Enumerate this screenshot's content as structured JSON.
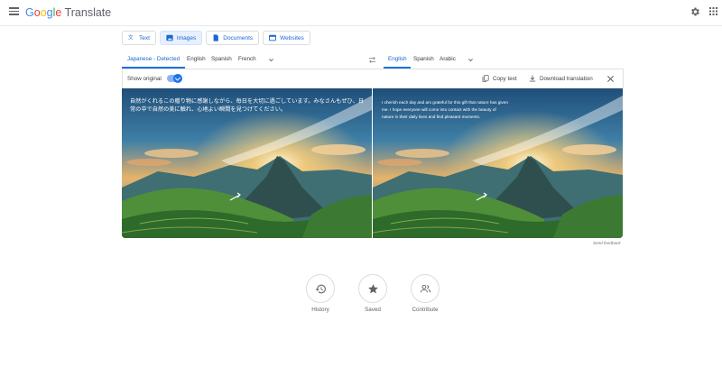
{
  "header": {
    "logo_parts": [
      "G",
      "o",
      "o",
      "g",
      "l",
      "e"
    ],
    "logo_rest": " Translate",
    "menu_icon": "hamburger-icon",
    "settings_icon": "gear-icon",
    "apps_icon": "apps-grid-icon"
  },
  "modes": [
    {
      "label": "Text",
      "icon": "translate-icon",
      "active": false
    },
    {
      "label": "Images",
      "icon": "image-icon",
      "active": true
    },
    {
      "label": "Documents",
      "icon": "document-icon",
      "active": false
    },
    {
      "label": "Websites",
      "icon": "website-icon",
      "active": false
    }
  ],
  "source_langs": [
    "Japanese - Detected",
    "English",
    "Spanish",
    "French"
  ],
  "target_langs": [
    "English",
    "Spanish",
    "Arabic"
  ],
  "toolbar": {
    "show_original": "Show original",
    "show_original_on": true,
    "copy_text": "Copy text",
    "download": "Download translation"
  },
  "overlay": {
    "original": "自然がくれるこの贈り物に感謝しながら、毎日を大切に過ごしています。みなさんもぜひ、日常の中で自然の美に触れ、心地よい瞬間を見つけてください。",
    "translated": "I cherish each day and am grateful for this gift that nature has given me. I hope everyone will come into contact with the beauty of nature in their daily lives and find pleasant moments."
  },
  "feedback": "Send feedback",
  "shortcuts": [
    {
      "label": "History",
      "icon": "history-icon"
    },
    {
      "label": "Saved",
      "icon": "star-icon"
    },
    {
      "label": "Contribute",
      "icon": "contribute-icon"
    }
  ],
  "colors": {
    "accent": "#1a73e8",
    "link": "#1967d2",
    "active_chip": "#e8f0fe"
  }
}
